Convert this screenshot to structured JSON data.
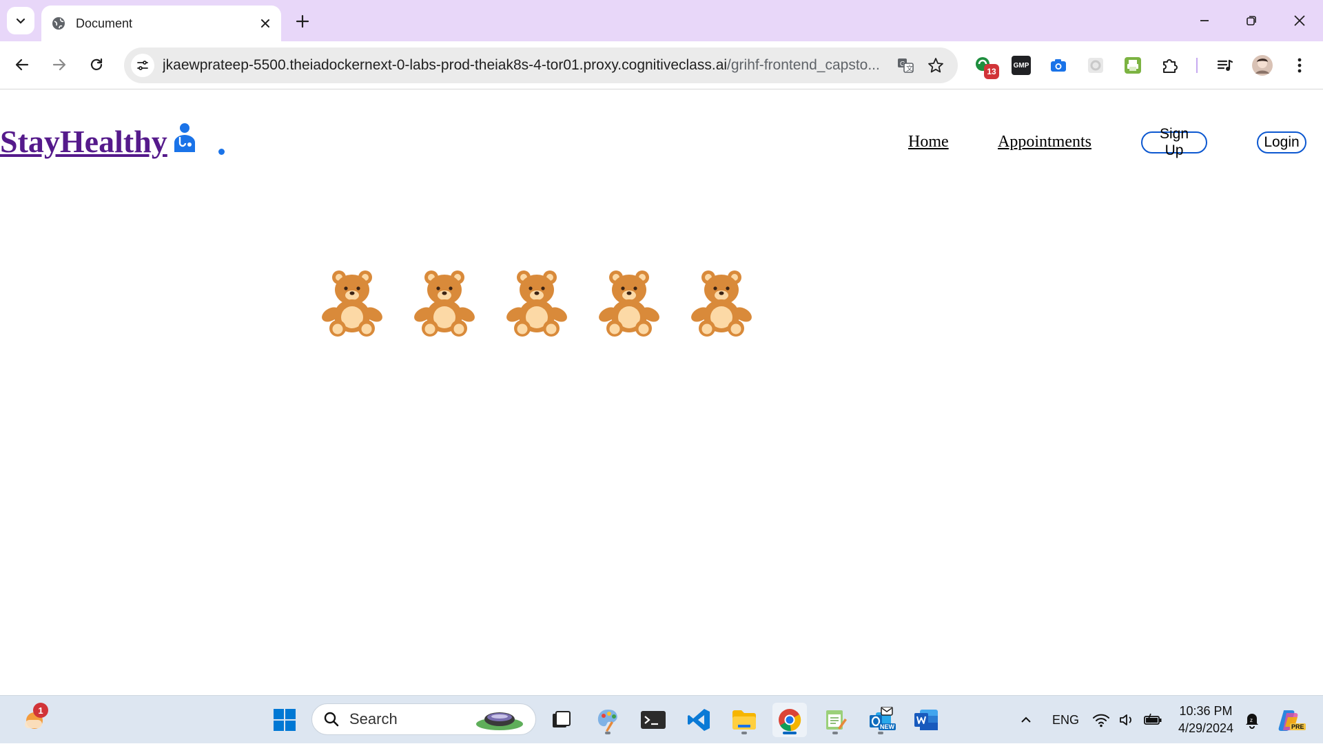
{
  "browser": {
    "tab_title": "Document",
    "url_host": "jkaewprateep-5500.theiadockernext-0-labs-prod-theiak8s-4-tor01.proxy.cognitiveclass.ai",
    "url_path": "/grihf-frontend_capsto...",
    "extension_badge": "13",
    "extension_gmp_label": "GMP"
  },
  "site": {
    "brand": "StayHealthy",
    "nav": {
      "home": "Home",
      "appointments": "Appointments",
      "signup": "Sign Up",
      "login": "Login"
    },
    "bears": [
      "teddy-bear",
      "teddy-bear",
      "teddy-bear",
      "teddy-bear",
      "teddy-bear"
    ]
  },
  "taskbar": {
    "search_placeholder": "Search",
    "weather_badge": "1",
    "language": "ENG",
    "time": "10:36 PM",
    "date": "4/29/2024",
    "outlook_badge": "NEW",
    "copilot_badge": "PRE"
  },
  "colors": {
    "tabbar": "#e8d7f9",
    "brand_link": "#551a8b",
    "button_border": "#0b57d0",
    "bear_body": "#d98a3a",
    "bear_belly": "#fcd9a6"
  }
}
